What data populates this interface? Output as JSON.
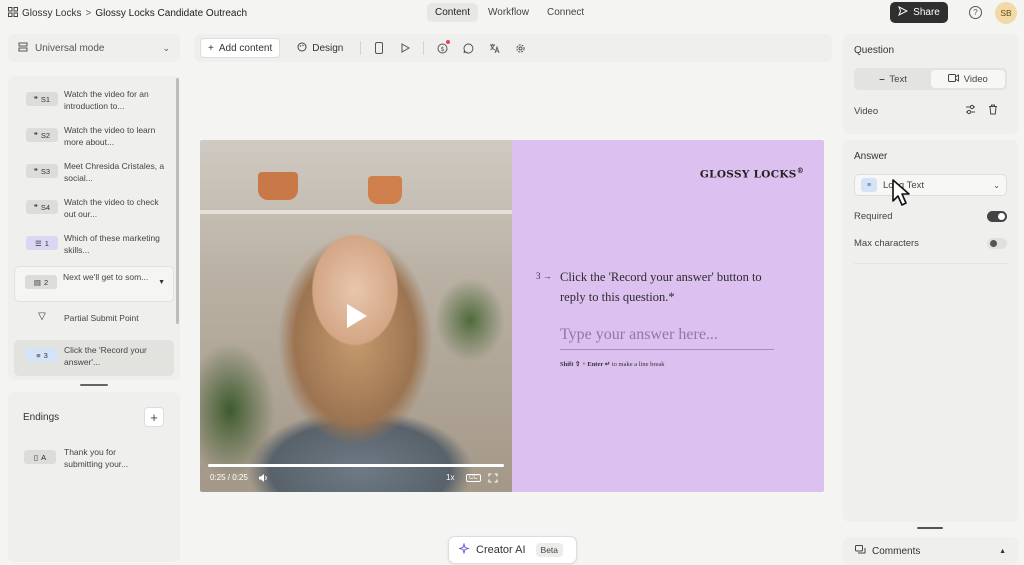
{
  "breadcrumb": {
    "workspace": "Glossy Locks",
    "separator": ">",
    "project": "Glossy Locks Candidate Outreach"
  },
  "nav": {
    "tabs": [
      {
        "label": "Content",
        "active": true
      },
      {
        "label": "Workflow",
        "active": false
      },
      {
        "label": "Connect",
        "active": false
      }
    ]
  },
  "header": {
    "share_label": "Share",
    "help_glyph": "?",
    "avatar_initials": "SB"
  },
  "sidebar": {
    "mode_label": "Universal mode",
    "items": [
      {
        "tag": "S1",
        "label": "Watch the video for an introduction to...",
        "kind": "quote"
      },
      {
        "tag": "S2",
        "label": "Watch the video to learn more about...",
        "kind": "quote"
      },
      {
        "tag": "S3",
        "label": "Meet Chresida Cristales, a social...",
        "kind": "quote"
      },
      {
        "tag": "S4",
        "label": "Watch the video to check out our...",
        "kind": "quote"
      },
      {
        "tag": "1",
        "label": "Which of these marketing skills...",
        "kind": "choice"
      },
      {
        "tag": "2",
        "label": "Next we'll get to som...",
        "kind": "group"
      },
      {
        "tag": "",
        "label": "Partial Submit Point",
        "kind": "partial"
      },
      {
        "tag": "3",
        "label": "Click the 'Record your answer'...",
        "kind": "text",
        "selected": true
      }
    ],
    "endings_title": "Endings",
    "add_glyph": "+",
    "endings": [
      {
        "tag": "A",
        "label": "Thank you for submitting your..."
      }
    ]
  },
  "toolbar": {
    "add_content_label": "Add content",
    "design_label": "Design"
  },
  "video": {
    "time": "0:25 / 0:25",
    "speed": "1x",
    "cc": "CC",
    "progress": 1.0
  },
  "form_preview": {
    "brand": "GLOSSY LOCKS",
    "brand_mark": "®",
    "question_number": "3",
    "question_arrow": "→",
    "question_text": "Click the 'Record your answer' button to reply to this question.*",
    "answer_placeholder": "Type your answer here...",
    "hint_shift": "Shift ⇧",
    "hint_plus": " + ",
    "hint_enter": "Enter ↵",
    "hint_rest": " to make a line break"
  },
  "right_panel": {
    "question_title": "Question",
    "segment_text": "Text",
    "segment_video": "Video",
    "video_label": "Video",
    "answer_title": "Answer",
    "answer_type": "Long Text",
    "required_label": "Required",
    "required_on": true,
    "max_chars_label": "Max characters",
    "max_chars_on": false,
    "comments_label": "Comments"
  },
  "creator_ai": {
    "label": "Creator AI",
    "badge": "Beta"
  },
  "colors": {
    "form_bg": "#dcc0ef",
    "share_bg": "#2f2f2f",
    "avatar_bg": "#f2d9a6"
  }
}
